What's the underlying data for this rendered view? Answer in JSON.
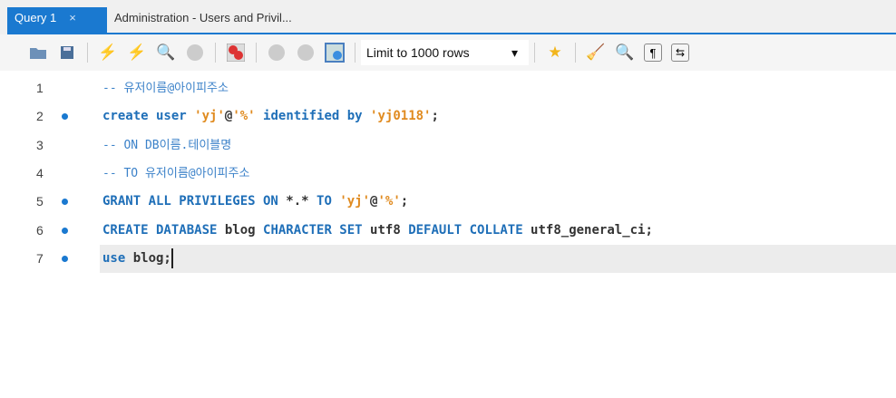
{
  "tabs": [
    {
      "label": "Query 1",
      "close": "×",
      "active": true
    },
    {
      "label": "Administration - Users and Privil..."
    }
  ],
  "toolbar": {
    "limit_label": "Limit to 1000 rows",
    "dropdown": "▾",
    "icons": [
      "open-folder-icon",
      "save-icon",
      "execute-icon",
      "execute-current-icon",
      "explain-icon",
      "stop-icon",
      "toggle-error-stop-icon",
      "commit-icon",
      "rollback-icon",
      "autocommit-icon",
      "add-snippet-icon",
      "beautify-icon",
      "find-icon",
      "invisible-chars-icon",
      "word-wrap-icon"
    ]
  },
  "editor": {
    "lines": [
      {
        "n": "1",
        "dot": false,
        "tokens": [
          {
            "t": "-- 유저이름@아이피주소",
            "c": "cm"
          }
        ]
      },
      {
        "n": "2",
        "dot": true,
        "tokens": [
          {
            "t": "create user ",
            "c": "kw"
          },
          {
            "t": "'yj'",
            "c": "str"
          },
          {
            "t": "@",
            "c": "tx"
          },
          {
            "t": "'%'",
            "c": "str"
          },
          {
            "t": " identified by ",
            "c": "kw"
          },
          {
            "t": "'yj0118'",
            "c": "str"
          },
          {
            "t": ";",
            "c": "tx"
          }
        ]
      },
      {
        "n": "3",
        "dot": false,
        "tokens": [
          {
            "t": "-- ON DB이름.테이블명",
            "c": "cm"
          }
        ]
      },
      {
        "n": "4",
        "dot": false,
        "tokens": [
          {
            "t": "-- TO 유저이름@아이피주소",
            "c": "cm"
          }
        ]
      },
      {
        "n": "5",
        "dot": true,
        "tokens": [
          {
            "t": "GRANT ALL PRIVILEGES ON ",
            "c": "kw"
          },
          {
            "t": "*.*",
            "c": "tx"
          },
          {
            "t": " TO ",
            "c": "kw"
          },
          {
            "t": "'yj'",
            "c": "str"
          },
          {
            "t": "@",
            "c": "tx"
          },
          {
            "t": "'%'",
            "c": "str"
          },
          {
            "t": ";",
            "c": "tx"
          }
        ]
      },
      {
        "n": "6",
        "dot": true,
        "tokens": [
          {
            "t": "CREATE DATABASE ",
            "c": "kw"
          },
          {
            "t": "blog ",
            "c": "tx"
          },
          {
            "t": "CHARACTER SET ",
            "c": "kw"
          },
          {
            "t": "utf8 ",
            "c": "tx"
          },
          {
            "t": "DEFAULT COLLATE ",
            "c": "kw"
          },
          {
            "t": "utf8_general_ci;",
            "c": "tx"
          }
        ]
      },
      {
        "n": "7",
        "dot": true,
        "current": true,
        "tokens": [
          {
            "t": "use ",
            "c": "kw"
          },
          {
            "t": "blog;",
            "c": "tx"
          }
        ]
      }
    ]
  }
}
